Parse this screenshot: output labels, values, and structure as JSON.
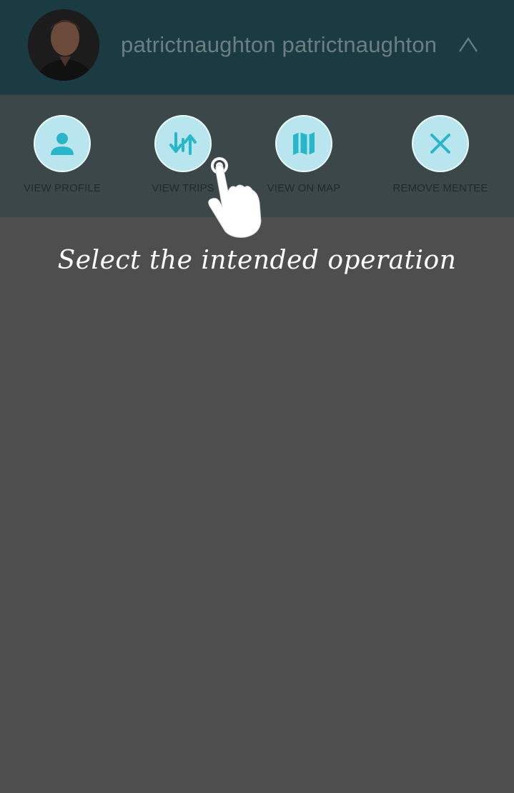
{
  "header": {
    "username": "patrictnaughton patrictnaughton",
    "avatar_icon": "user-photo",
    "collapse_icon": "chevron-up-icon"
  },
  "actions": [
    {
      "label": "VIEW PROFILE",
      "icon": "person-icon"
    },
    {
      "label": "VIEW TRIPS",
      "icon": "trips-icon"
    },
    {
      "label": "VIEW ON MAP",
      "icon": "map-icon"
    },
    {
      "label": "REMOVE MENTEE",
      "icon": "close-icon"
    }
  ],
  "tutorial": {
    "hint": "Select the intended operation",
    "pointer_icon": "hand-pointer-icon"
  },
  "colors": {
    "header_bg": "#1b3b42",
    "actions_bg": "#3b4749",
    "overlay_bg": "#4e4e4e",
    "icon_accent": "#29b6c9",
    "icon_circle": "#b9e6ee"
  }
}
